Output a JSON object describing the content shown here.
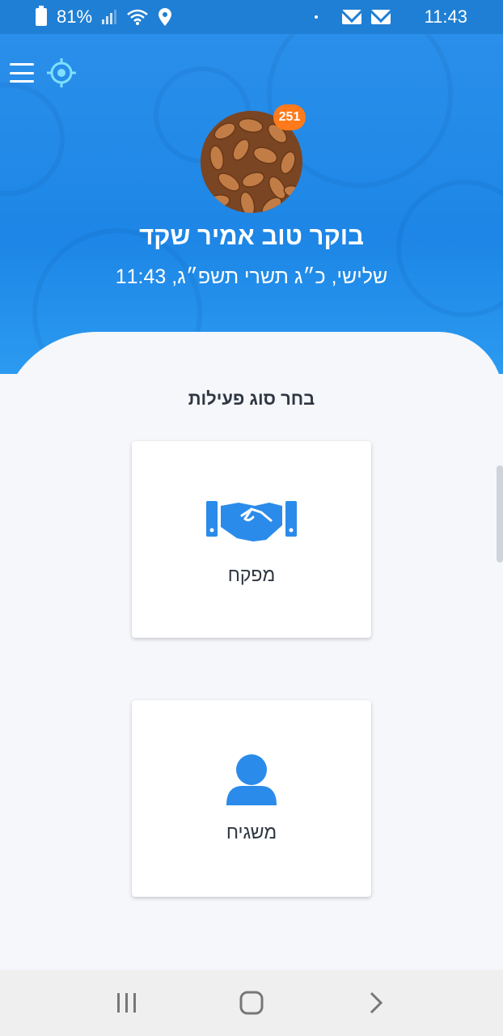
{
  "status_bar": {
    "battery": "81%",
    "time": "11:43",
    "icons": [
      "battery-icon",
      "signal-icon",
      "wifi-icon",
      "location-icon",
      "mail-icon",
      "mail-icon"
    ]
  },
  "header": {
    "menu_icon": "hamburger-menu-icon",
    "locate_icon": "crosshair-icon",
    "badge_count": "251",
    "avatar_image": "almonds-photo",
    "greeting": "בוקר טוב אמיר שקד",
    "date_line": "שלישי, כ״ג תשרי תשפ״ג, 11:43"
  },
  "main": {
    "section_title": "בחר סוג פעילות",
    "cards": [
      {
        "label": "מפקח",
        "icon": "handshake-icon"
      },
      {
        "label": "משגיח",
        "icon": "user-icon"
      }
    ]
  },
  "nav": {
    "recent_icon": "recent-apps-icon",
    "home_icon": "home-icon",
    "back_icon": "back-icon"
  },
  "colors": {
    "primary": "#1d86e6",
    "badge": "#ff7a1a",
    "icon_blue": "#2a8bea"
  }
}
